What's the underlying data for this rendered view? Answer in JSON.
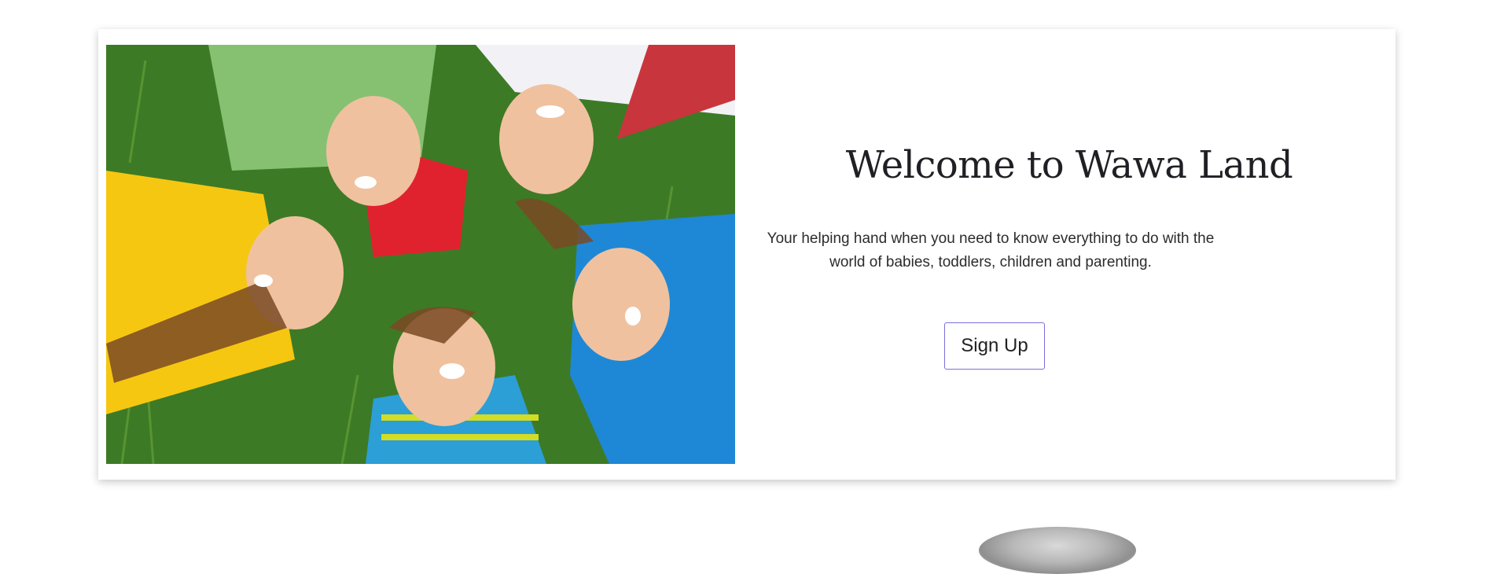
{
  "hero": {
    "title": "Welcome to Wawa Land",
    "subtitle": "Your helping hand when you need to know everything to do with the world of babies, toddlers, children and parenting.",
    "signup_label": "Sign Up",
    "photo_icon": "kids-circle-photo"
  },
  "colors": {
    "page_background": "#ffffff",
    "button_border": "#7b6fe0",
    "title_text": "#1f1f24"
  }
}
